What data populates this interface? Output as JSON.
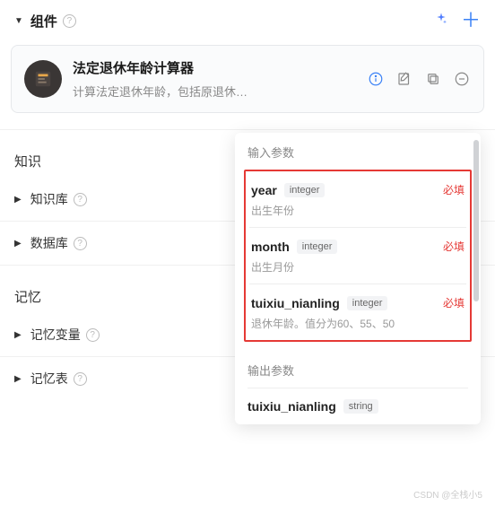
{
  "header": {
    "title": "组件",
    "sparkle_icon": "✦",
    "plus_icon": "+"
  },
  "component": {
    "title": "法定退休年龄计算器",
    "description": "计算法定退休年龄，包括原退休年..."
  },
  "sections": {
    "knowledge_title": "知识",
    "memory_title": "记忆",
    "items": {
      "knowledge_base": "知识库",
      "database": "数据库",
      "memory_vars": "记忆变量",
      "memory_table": "记忆表"
    }
  },
  "popover": {
    "input_label": "输入参数",
    "output_label": "输出参数",
    "required_label": "必填",
    "inputs": [
      {
        "name": "year",
        "type": "integer",
        "required": true,
        "desc": "出生年份"
      },
      {
        "name": "month",
        "type": "integer",
        "required": true,
        "desc": "出生月份"
      },
      {
        "name": "tuixiu_nianling",
        "type": "integer",
        "required": true,
        "desc": "退休年龄。值分为60、55、50"
      }
    ],
    "outputs": [
      {
        "name": "tuixiu_nianling",
        "type": "string"
      }
    ]
  },
  "watermark": "CSDN @全栈小5"
}
